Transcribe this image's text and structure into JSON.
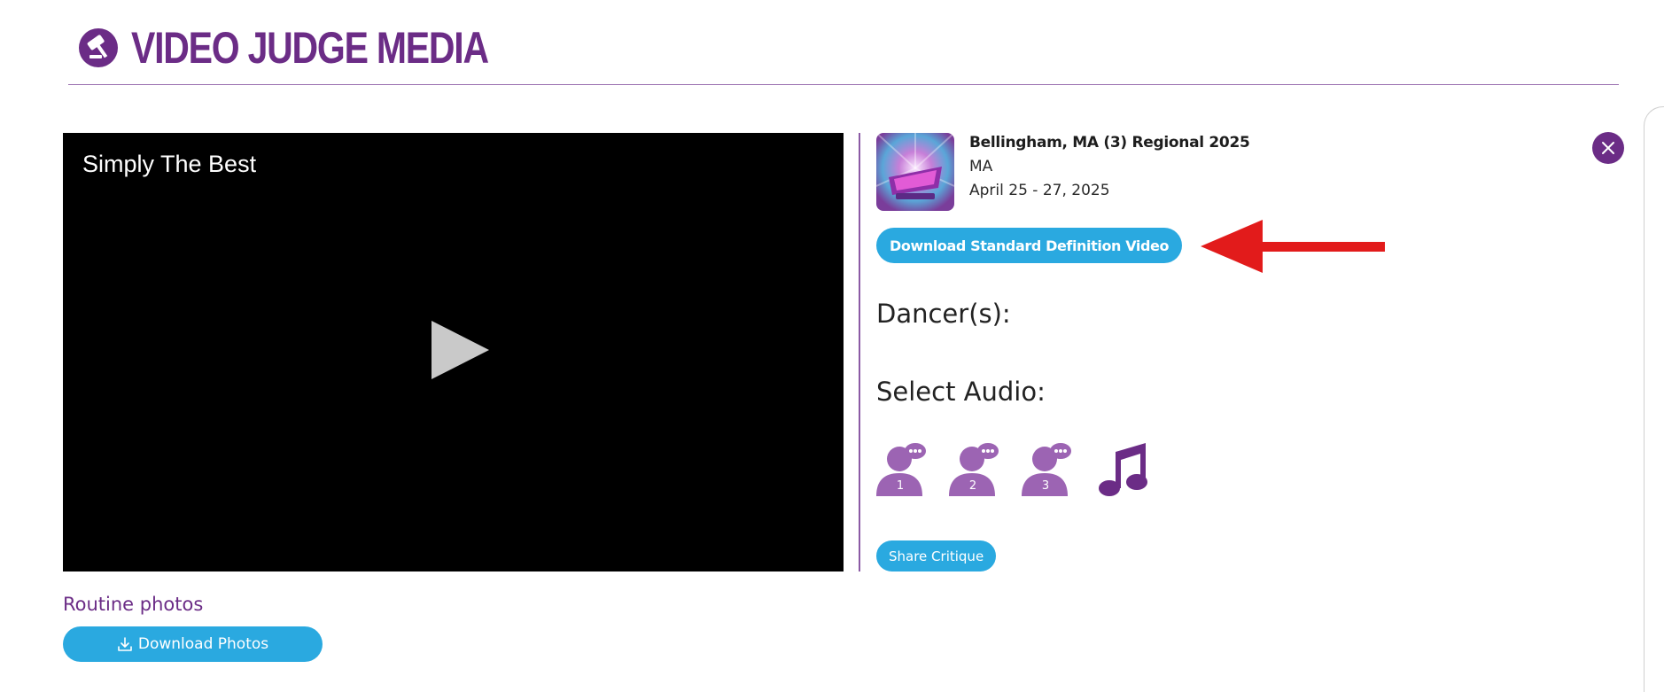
{
  "brand": {
    "name": "VIDEO JUDGE MEDIA",
    "color": "#6b2c86",
    "icon": "gavel-icon"
  },
  "video": {
    "title": "Simply The Best",
    "play_icon": "play-icon"
  },
  "event": {
    "logo_icon": "event-logo",
    "name": "Bellingham, MA (3) Regional 2025",
    "state": "MA",
    "dates": "April 25 - 27, 2025"
  },
  "download_sd_label": "Download Standard Definition Video",
  "dancers_heading": "Dancer(s):",
  "audio": {
    "heading": "Select Audio:",
    "options": [
      {
        "icon": "judge-speech-icon",
        "label": "1"
      },
      {
        "icon": "judge-speech-icon",
        "label": "2"
      },
      {
        "icon": "judge-speech-icon",
        "label": "3"
      },
      {
        "icon": "music-note-icon"
      }
    ]
  },
  "share_label": "Share Critique",
  "routine_photos_label": "Routine photos",
  "download_photos_label": "Download Photos",
  "colors": {
    "accent": "#2aa9e0",
    "purple": "#6b2c86",
    "light_purple": "#9c64b3",
    "arrow": "#e21b1b"
  }
}
